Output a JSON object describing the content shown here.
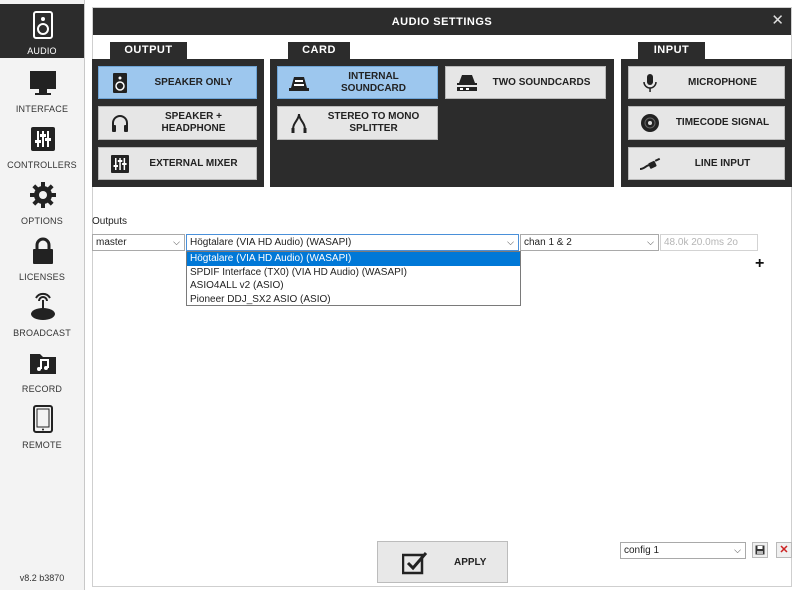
{
  "sidebar": {
    "items": [
      {
        "label": "AUDIO",
        "icon": "speaker-icon",
        "active": true
      },
      {
        "label": "INTERFACE",
        "icon": "monitor-icon"
      },
      {
        "label": "CONTROLLERS",
        "icon": "mixer-sliders-icon"
      },
      {
        "label": "OPTIONS",
        "icon": "gear-icon"
      },
      {
        "label": "LICENSES",
        "icon": "lock-icon"
      },
      {
        "label": "BROADCAST",
        "icon": "broadcast-icon"
      },
      {
        "label": "RECORD",
        "icon": "music-folder-icon"
      },
      {
        "label": "REMOTE",
        "icon": "tablet-icon"
      }
    ],
    "version": "v8.2 b3870"
  },
  "window": {
    "title": "AUDIO SETTINGS",
    "close": "✕"
  },
  "groups": {
    "output": {
      "title": "OUTPUT",
      "options": [
        {
          "label": "SPEAKER ONLY",
          "icon": "speaker-icon",
          "selected": true
        },
        {
          "label": "SPEAKER + HEADPHONE",
          "icon": "headphones-icon"
        },
        {
          "label": "EXTERNAL MIXER",
          "icon": "mixer-icon"
        }
      ]
    },
    "card": {
      "title": "CARD",
      "options": [
        {
          "label": "INTERNAL SOUNDCARD",
          "icon": "soundcard-icon",
          "selected": true
        },
        {
          "label": "TWO SOUNDCARDS",
          "icon": "two-soundcards-icon"
        },
        {
          "label": "STEREO TO MONO SPLITTER",
          "icon": "splitter-cable-icon"
        }
      ]
    },
    "input": {
      "title": "INPUT",
      "options": [
        {
          "label": "MICROPHONE",
          "icon": "microphone-icon"
        },
        {
          "label": "TIMECODE SIGNAL",
          "icon": "vinyl-icon"
        },
        {
          "label": "LINE INPUT",
          "icon": "line-cable-icon"
        }
      ]
    }
  },
  "outputs": {
    "label": "Outputs",
    "channel": "master",
    "device": "Högtalare (VIA HD Audio) (WASAPI)",
    "channels": "chan 1 & 2",
    "status": "48.0k 20.0ms 2o",
    "dropdown": [
      "Högtalare (VIA HD Audio) (WASAPI)",
      "SPDIF Interface (TX0) (VIA HD Audio) (WASAPI)",
      "ASIO4ALL v2 (ASIO)",
      "Pioneer DDJ_SX2 ASIO (ASIO)"
    ],
    "add": "+"
  },
  "footer": {
    "apply": "APPLY",
    "config": "config 1"
  },
  "colors": {
    "dark": "#2c2c2c",
    "selected": "#9dc7ee",
    "highlight": "#0078d7",
    "delete": "#cc2222"
  }
}
